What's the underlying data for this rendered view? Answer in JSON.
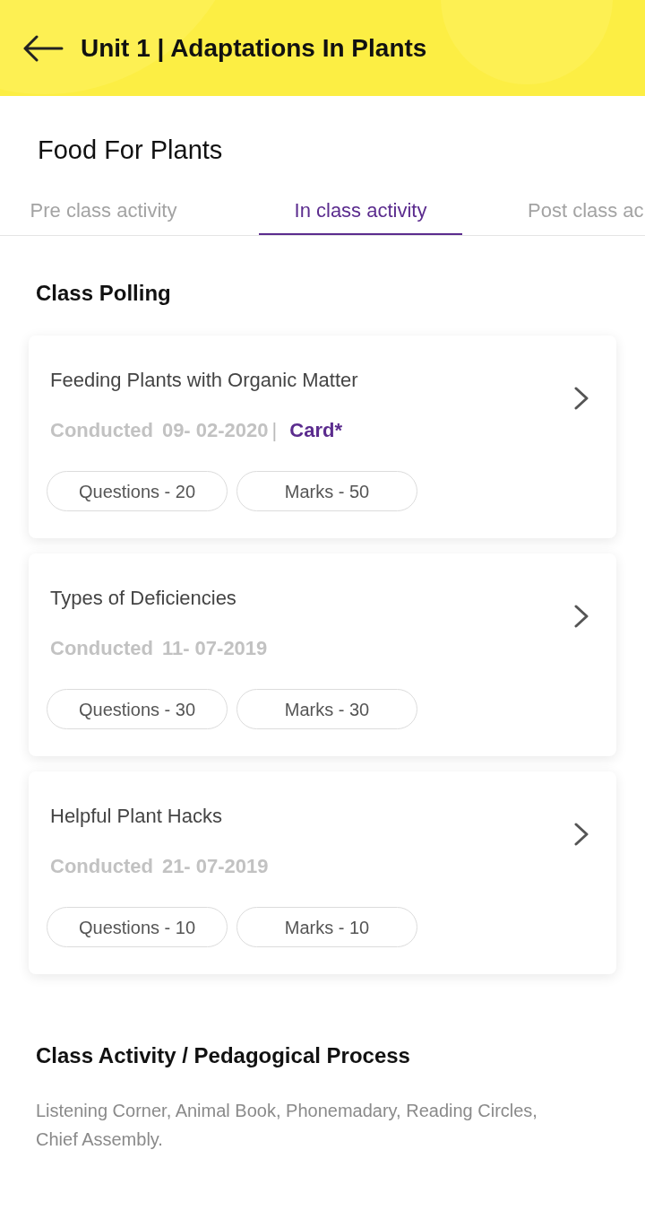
{
  "header": {
    "title": "Unit 1 | Adaptations In Plants"
  },
  "page_title": "Food For Plants",
  "tabs": [
    {
      "label": "Pre class activity",
      "selected": false
    },
    {
      "label": "In class activity",
      "selected": true
    },
    {
      "label": "Post class ac",
      "selected": false
    }
  ],
  "class_polling": {
    "heading": "Class Polling",
    "polls": [
      {
        "title": "Feeding Plants with Organic Matter",
        "conducted_label": "Conducted",
        "date": "09- 02-2020",
        "separator": "|",
        "tag": "Card*",
        "chips": [
          "Questions - 20",
          "Marks - 50"
        ]
      },
      {
        "title": "Types of Deficiencies",
        "conducted_label": "Conducted",
        "date": "11- 07-2019",
        "chips": [
          "Questions - 30",
          "Marks - 30"
        ]
      },
      {
        "title": "Helpful Plant Hacks",
        "conducted_label": "Conducted",
        "date": "21- 07-2019",
        "chips": [
          "Questions - 10",
          "Marks - 10"
        ]
      }
    ]
  },
  "class_activity": {
    "heading": "Class Activity / Pedagogical Process",
    "text": "Listening Corner, Animal Book, Phonemadary, Reading Circles, Chief Assembly."
  }
}
